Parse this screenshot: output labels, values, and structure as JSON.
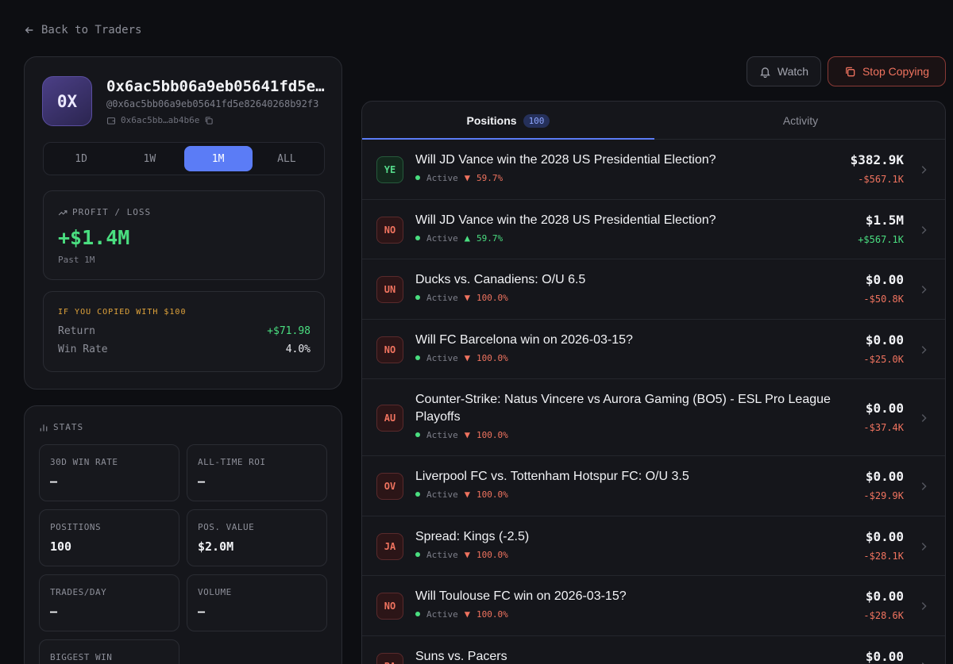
{
  "nav": {
    "back_label": "Back to Traders"
  },
  "trader": {
    "avatar_text": "0X",
    "name": "0x6ac5bb06a9eb05641fd5e82640268b92f3",
    "handle": "@0x6ac5bb06a9eb05641fd5e82640268b92f3",
    "wallet_short": "0x6ac5bb…ab4b6e"
  },
  "ranges": [
    {
      "label": "1D",
      "active": false
    },
    {
      "label": "1W",
      "active": false
    },
    {
      "label": "1M",
      "active": true
    },
    {
      "label": "ALL",
      "active": false
    }
  ],
  "profit_loss": {
    "label": "PROFIT / LOSS",
    "value": "+$1.4M",
    "period": "Past 1M"
  },
  "copy_sim": {
    "title": "IF YOU COPIED WITH $100",
    "return_label": "Return",
    "return_value": "+$71.98",
    "win_rate_label": "Win Rate",
    "win_rate_value": "4.0%"
  },
  "stats": {
    "title": "STATS",
    "items": [
      {
        "label": "30D WIN RATE",
        "value": "–"
      },
      {
        "label": "ALL-TIME ROI",
        "value": "–"
      },
      {
        "label": "POSITIONS",
        "value": "100"
      },
      {
        "label": "POS. VALUE",
        "value": "$2.0M"
      },
      {
        "label": "TRADES/DAY",
        "value": "–"
      },
      {
        "label": "VOLUME",
        "value": "–"
      },
      {
        "label": "BIGGEST WIN",
        "value": ""
      }
    ]
  },
  "actions": {
    "watch_label": "Watch",
    "stop_label": "Stop Copying"
  },
  "tabs": {
    "positions_label": "Positions",
    "positions_count": "100",
    "activity_label": "Activity"
  },
  "colors": {
    "accent": "#5b7cf6",
    "positive": "#4ade80",
    "negative": "#f0735f",
    "warning": "#e0a33b"
  },
  "positions": [
    {
      "badge": "YE",
      "badge_color": "green",
      "title": "Will JD Vance win the 2028 US Presidential Election?",
      "status": "Active",
      "direction": "down",
      "pct": "59.7%",
      "value": "$382.9K",
      "pnl": "-$567.1K"
    },
    {
      "badge": "NO",
      "badge_color": "red",
      "title": "Will JD Vance win the 2028 US Presidential Election?",
      "status": "Active",
      "direction": "up",
      "pct": "59.7%",
      "value": "$1.5M",
      "pnl": "+$567.1K"
    },
    {
      "badge": "UN",
      "badge_color": "red",
      "title": "Ducks vs. Canadiens: O/U 6.5",
      "status": "Active",
      "direction": "down",
      "pct": "100.0%",
      "value": "$0.00",
      "pnl": "-$50.8K"
    },
    {
      "badge": "NO",
      "badge_color": "red",
      "title": "Will FC Barcelona win on 2026-03-15?",
      "status": "Active",
      "direction": "down",
      "pct": "100.0%",
      "value": "$0.00",
      "pnl": "-$25.0K"
    },
    {
      "badge": "AU",
      "badge_color": "red",
      "title": "Counter-Strike: Natus Vincere vs Aurora Gaming (BO5) - ESL Pro League Playoffs",
      "status": "Active",
      "direction": "down",
      "pct": "100.0%",
      "value": "$0.00",
      "pnl": "-$37.4K"
    },
    {
      "badge": "OV",
      "badge_color": "red",
      "title": "Liverpool FC vs. Tottenham Hotspur FC: O/U 3.5",
      "status": "Active",
      "direction": "down",
      "pct": "100.0%",
      "value": "$0.00",
      "pnl": "-$29.9K"
    },
    {
      "badge": "JA",
      "badge_color": "red",
      "title": "Spread: Kings (-2.5)",
      "status": "Active",
      "direction": "down",
      "pct": "100.0%",
      "value": "$0.00",
      "pnl": "-$28.1K"
    },
    {
      "badge": "NO",
      "badge_color": "red",
      "title": "Will Toulouse FC win on 2026-03-15?",
      "status": "Active",
      "direction": "down",
      "pct": "100.0%",
      "value": "$0.00",
      "pnl": "-$28.6K"
    },
    {
      "badge": "PA",
      "badge_color": "red",
      "title": "Suns vs. Pacers",
      "status": "",
      "direction": "",
      "pct": "",
      "value": "$0.00",
      "pnl": ""
    }
  ]
}
